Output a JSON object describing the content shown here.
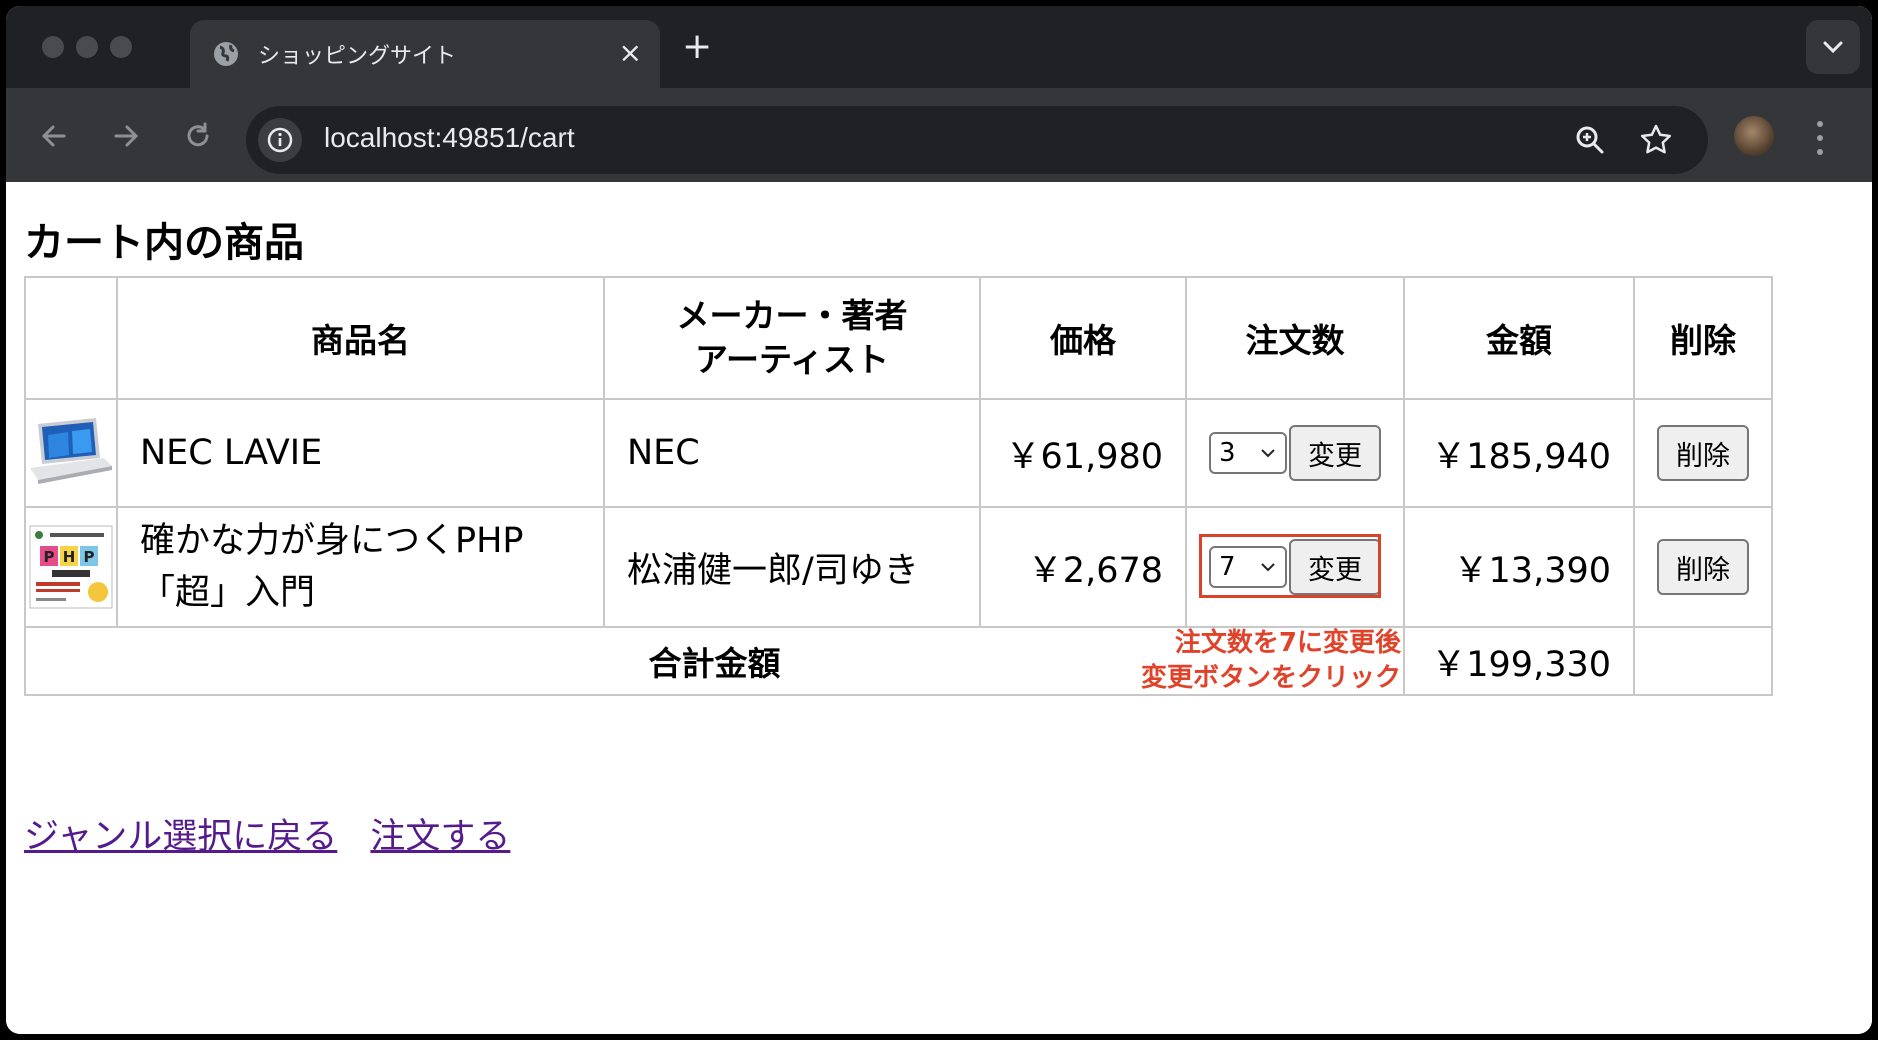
{
  "browser": {
    "tab_title": "ショッピングサイト",
    "tab_close": "×",
    "new_tab": "+",
    "url": "localhost:49851/cart",
    "icons": [
      "globe-icon",
      "back-arrow-icon",
      "forward-arrow-icon",
      "reload-icon",
      "site-info-icon",
      "zoom-icon",
      "bookmark-star-icon",
      "profile-avatar",
      "kebab-menu-icon",
      "tab-dropdown-icon"
    ]
  },
  "page": {
    "title": "カート内の商品",
    "table": {
      "headers": {
        "image": "",
        "name": "商品名",
        "maker_line1": "メーカー・著者",
        "maker_line2": "アーティスト",
        "price": "価格",
        "quantity": "注文数",
        "amount": "金額",
        "delete": "削除"
      },
      "rows": [
        {
          "name_line1": "NEC LAVIE",
          "name_line2": "",
          "maker": "NEC",
          "price": "￥61,980",
          "quantity": "3",
          "update_label": "変更",
          "amount": "￥185,940",
          "delete_label": "削除",
          "image": "laptop"
        },
        {
          "name_line1": "確かな力が身につくPHP",
          "name_line2": "「超」入門",
          "maker": "松浦健一郎/司ゆき",
          "price": "￥2,678",
          "quantity": "7",
          "update_label": "変更",
          "amount": "￥13,390",
          "delete_label": "削除",
          "image": "php-book"
        }
      ],
      "total_label": "合計金額",
      "total_amount": "￥199,330"
    },
    "annotation": {
      "line1": "注文数を7に変更後",
      "line2": "変更ボタンをクリック",
      "color": "#e0432a"
    },
    "links": {
      "back": "ジャンル選択に戻る",
      "order": "注文する"
    }
  }
}
